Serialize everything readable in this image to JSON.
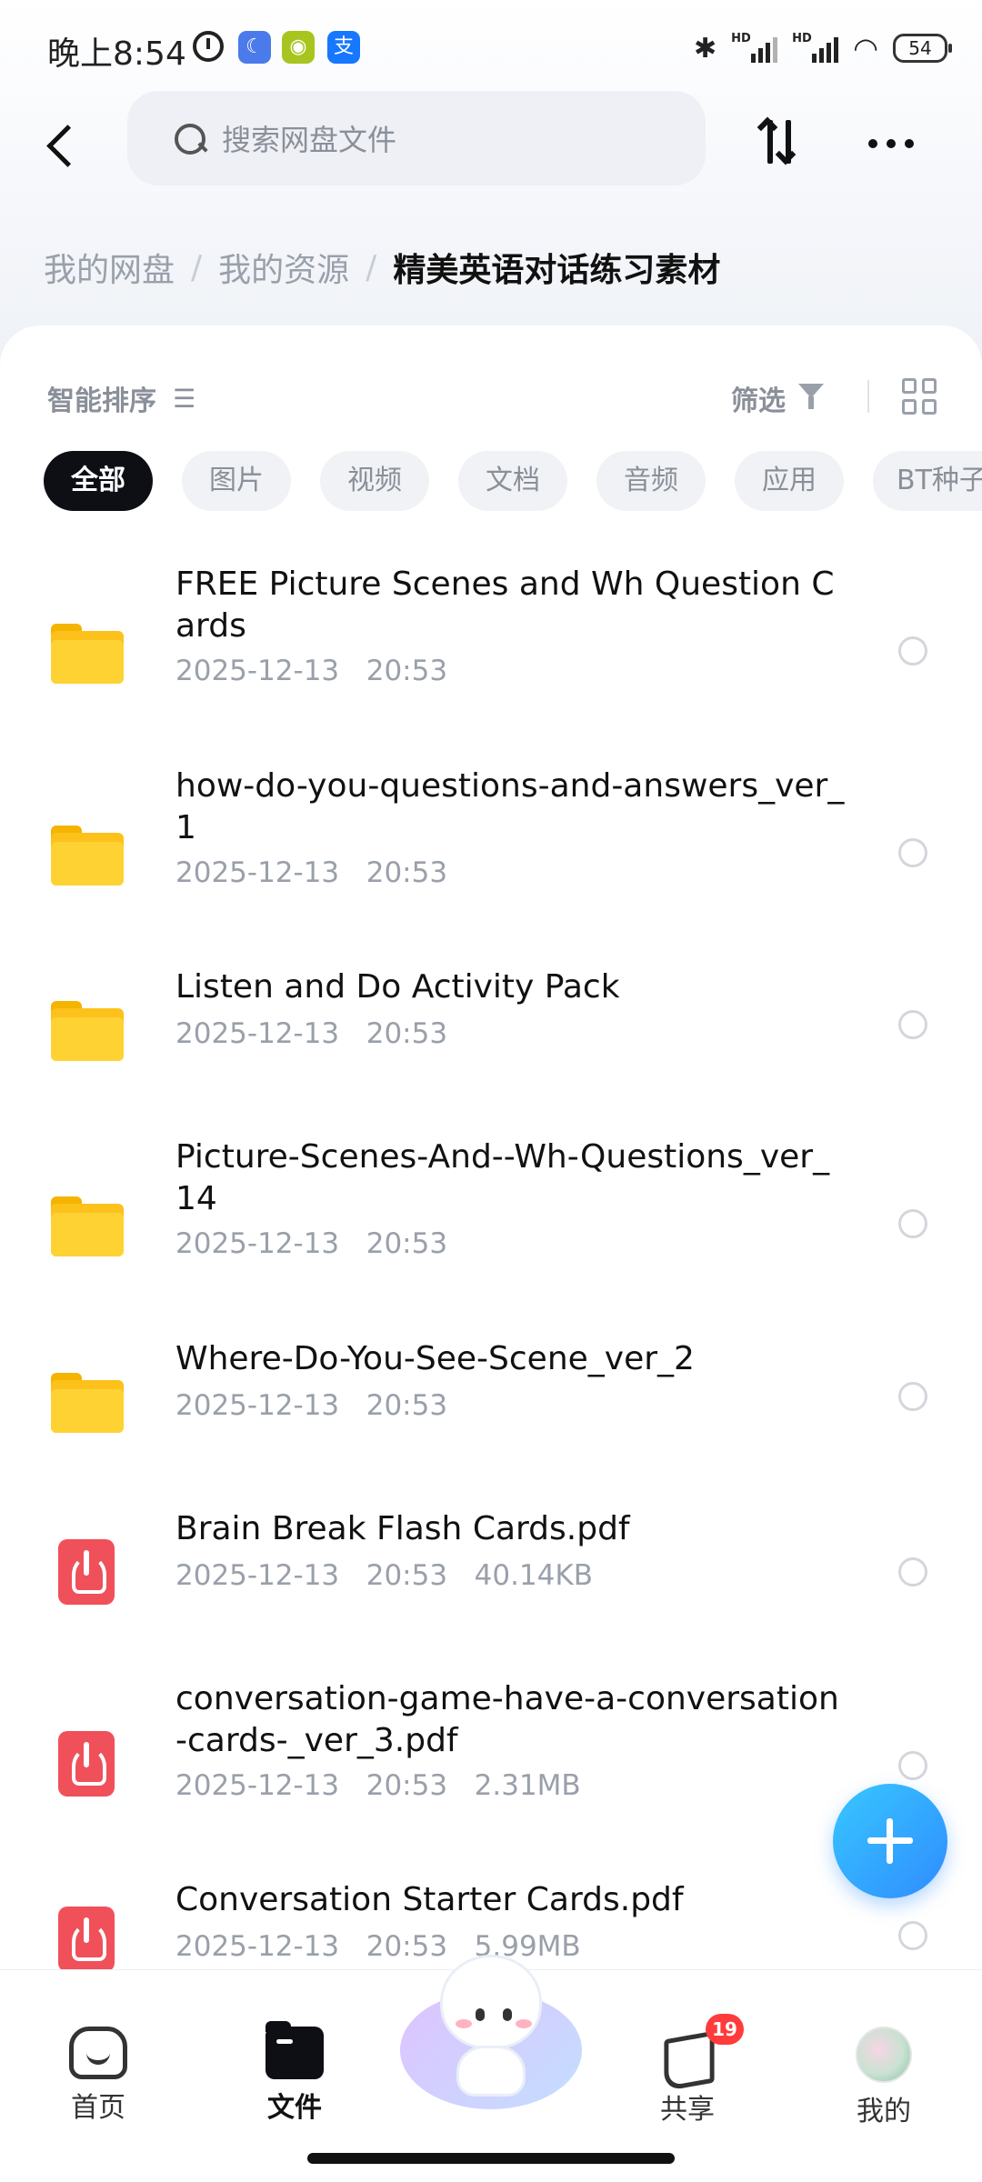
{
  "status_bar": {
    "time": "晚上8:54",
    "battery": "54"
  },
  "header": {
    "search_placeholder": "搜索网盘文件"
  },
  "breadcrumb": {
    "items": [
      "我的网盘",
      "我的资源"
    ],
    "separator": "/",
    "current": "精美英语对话练习素材"
  },
  "toolbar": {
    "sort_label": "智能排序",
    "filter_label": "筛选"
  },
  "filter_chips": [
    {
      "label": "全部",
      "active": true
    },
    {
      "label": "图片",
      "active": false
    },
    {
      "label": "视频",
      "active": false
    },
    {
      "label": "文档",
      "active": false
    },
    {
      "label": "音频",
      "active": false
    },
    {
      "label": "应用",
      "active": false
    },
    {
      "label": "BT种子",
      "active": false
    }
  ],
  "files": [
    {
      "type": "folder",
      "name": "FREE Picture Scenes and Wh Question Cards",
      "date": "2025-12-13",
      "time": "20:53",
      "size": ""
    },
    {
      "type": "folder",
      "name": "how-do-you-questions-and-answers_ver_1",
      "date": "2025-12-13",
      "time": "20:53",
      "size": ""
    },
    {
      "type": "folder",
      "name": "Listen and Do Activity Pack",
      "date": "2025-12-13",
      "time": "20:53",
      "size": ""
    },
    {
      "type": "folder",
      "name": "Picture-Scenes-And--Wh-Questions_ver_14",
      "date": "2025-12-13",
      "time": "20:53",
      "size": ""
    },
    {
      "type": "folder",
      "name": "Where-Do-You-See-Scene_ver_2",
      "date": "2025-12-13",
      "time": "20:53",
      "size": ""
    },
    {
      "type": "pdf",
      "name": "Brain Break Flash Cards.pdf",
      "date": "2025-12-13",
      "time": "20:53",
      "size": "40.14KB"
    },
    {
      "type": "pdf",
      "name": "conversation-game-have-a-conversation-cards-_ver_3.pdf",
      "date": "2025-12-13",
      "time": "20:53",
      "size": "2.31MB"
    },
    {
      "type": "pdf",
      "name": "Conversation Starter Cards.pdf",
      "date": "2025-12-13",
      "time": "20:53",
      "size": "5.99MB"
    }
  ],
  "bottom_nav": {
    "items": [
      {
        "label": "首页",
        "icon": "home-icon",
        "active": false
      },
      {
        "label": "文件",
        "icon": "file-icon",
        "active": true
      },
      {
        "label": "共享",
        "icon": "share-icon",
        "active": false,
        "badge": "19"
      },
      {
        "label": "我的",
        "icon": "avatar-icon",
        "active": false
      }
    ]
  },
  "colors": {
    "accent": "#2f8cff",
    "folder": "#ffd234",
    "pdf": "#f0505a",
    "badge": "#ff3b3b"
  }
}
